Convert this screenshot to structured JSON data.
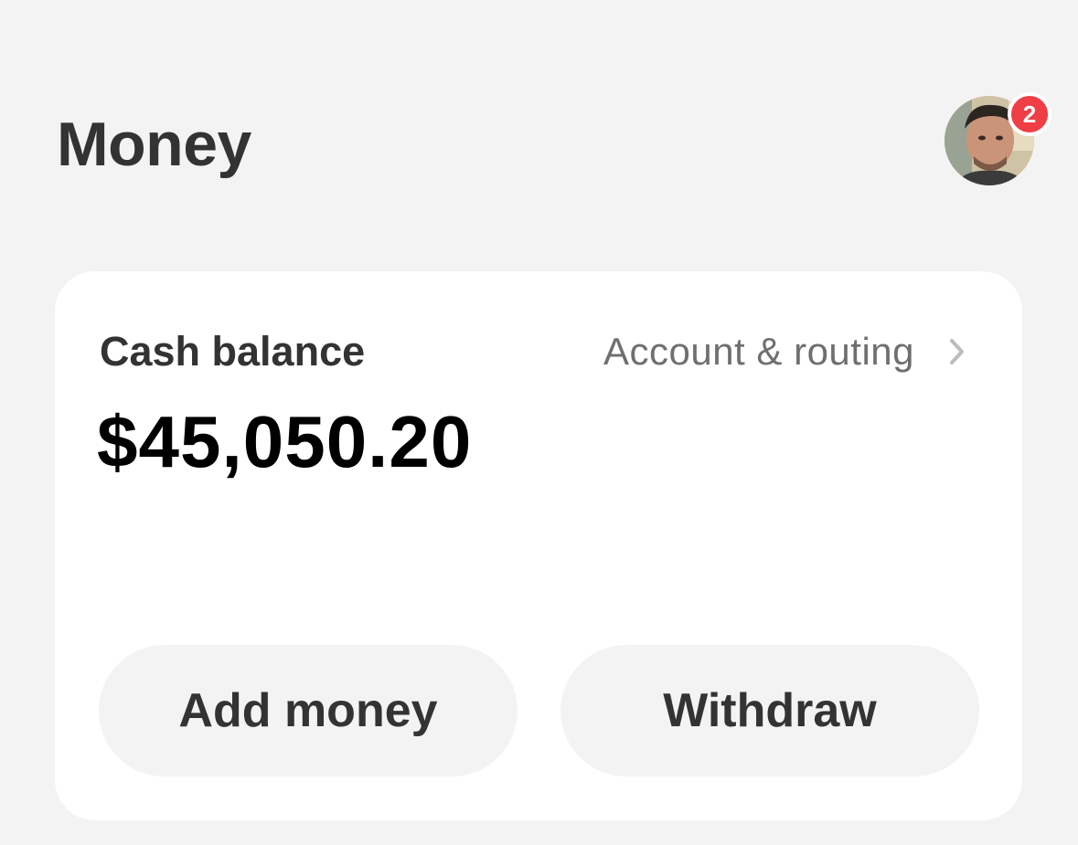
{
  "header": {
    "title": "Money",
    "notification_count": "2",
    "avatar_icon": "user-photo"
  },
  "balance_card": {
    "label": "Cash balance",
    "amount": "$45,050.20",
    "account_link_label": "Account & routing",
    "account_link_icon": "chevron-right-icon"
  },
  "actions": {
    "add_money_label": "Add money",
    "withdraw_label": "Withdraw"
  },
  "colors": {
    "background": "#f3f3f3",
    "card": "#ffffff",
    "badge": "#ef3e45",
    "text_primary": "#333333",
    "text_secondary": "#6f6f6f",
    "amount": "#000000"
  }
}
